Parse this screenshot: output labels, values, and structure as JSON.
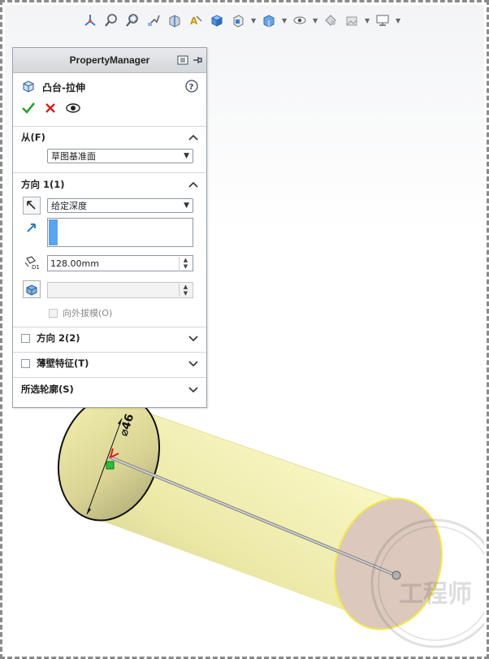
{
  "toolbar": {
    "icons": [
      "view-orientation-icon",
      "zoom-to-fit-icon",
      "zoom-area-icon",
      "previous-view-icon",
      "section-view-icon",
      "dynamic-annotation-icon",
      "view-cube-icon",
      "standard-views-icon",
      "display-style-icon",
      "hide-show-icon",
      "appearance-icon",
      "scene-icon",
      "display-settings-icon"
    ]
  },
  "property_manager": {
    "header_title": "PropertyManager",
    "feature_title": "凸台-拉伸",
    "from_section": {
      "label": "从(F)",
      "selected": "草图基准面"
    },
    "direction1_section": {
      "label": "方向 1(1)",
      "end_condition": "给定深度",
      "depth_value": "128.00mm",
      "draft_value": "",
      "draft_outward_label": "向外拔模(O)"
    },
    "direction2_section": {
      "label": "方向 2(2)"
    },
    "thin_feature_section": {
      "label": "薄壁特征(T)"
    },
    "selected_contours_section": {
      "label": "所选轮廓(S)"
    }
  },
  "model": {
    "diameter_label": "⌀46",
    "cylinder_color": "#f1eea8",
    "end_face_color": "#dcc8bd",
    "edge_highlight_color": "#f2e94a"
  },
  "watermark_text": "工程师"
}
